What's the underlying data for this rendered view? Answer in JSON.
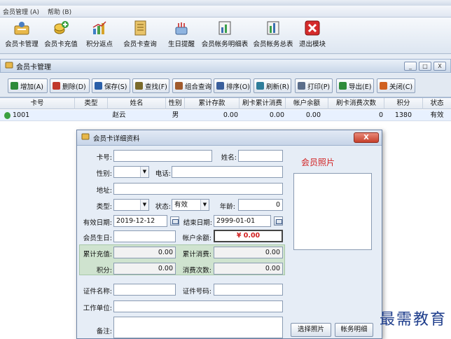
{
  "menubar": {
    "items": [
      "会员管理 (A)",
      "帮助 (B)"
    ]
  },
  "toolbar": {
    "buttons": [
      {
        "label": "会员卡管理",
        "icon": "member-card-icon"
      },
      {
        "label": "会员卡充值",
        "icon": "coins-add-icon"
      },
      {
        "label": "积分返点",
        "icon": "chart-icon"
      },
      {
        "label": "会员卡查询",
        "icon": "notebook-icon"
      },
      {
        "label": "生日提醒",
        "icon": "birthday-icon"
      },
      {
        "label": "会员帐务明细表",
        "icon": "ledger-icon"
      },
      {
        "label": "会员帐务总表",
        "icon": "summary-ledger-icon"
      },
      {
        "label": "退出模块",
        "icon": "exit-icon"
      }
    ]
  },
  "child_window": {
    "title": "会员卡管理",
    "controls": [
      "_",
      "□",
      "X"
    ]
  },
  "actions": [
    {
      "label": "增加(A)",
      "color": "#2e8b3a"
    },
    {
      "label": "删除(D)",
      "color": "#c0392b"
    },
    {
      "label": "保存(S)",
      "color": "#2b5fa8"
    },
    {
      "label": "查找(F)",
      "color": "#7a6a2b"
    },
    {
      "label": "组合查询",
      "color": "#a05a2c"
    },
    {
      "label": "排序(O)",
      "color": "#3a5f9c"
    },
    {
      "label": "刷新(R)",
      "color": "#2e7d9a"
    },
    {
      "label": "打印(P)",
      "color": "#5a6d8a"
    },
    {
      "label": "导出(E)",
      "color": "#2e8b3a"
    },
    {
      "label": "关闭(C)",
      "color": "#d06020"
    }
  ],
  "table": {
    "columns": [
      "卡号",
      "类型",
      "姓名",
      "性别",
      "累计存款",
      "刷卡累计消费",
      "帐户余额",
      "刷卡消费次数",
      "积分",
      "状态"
    ],
    "rows": [
      [
        "1001",
        "",
        "赵云",
        "男",
        "0.00",
        "0.00",
        "0.00",
        "0",
        "1380",
        "有效"
      ]
    ]
  },
  "dialog": {
    "title": "会员卡详细资料",
    "close_label": "X",
    "labels": {
      "card_no": "卡号:",
      "name": "姓名:",
      "gender": "性别:",
      "phone": "电话:",
      "address": "地址:",
      "type": "类型:",
      "status": "状态:",
      "age": "年龄:",
      "valid_date": "有效日期:",
      "end_date": "结束日期:",
      "birthday": "会员生日:",
      "balance": "帐户余额:",
      "total_recharge": "累计充值:",
      "total_consume": "累计消费:",
      "points": "积分:",
      "consume_count": "消费次数:",
      "cert_name": "证件名称:",
      "cert_no": "证件号码:",
      "workplace": "工作单位:",
      "remark": "备注:"
    },
    "values": {
      "card_no": "",
      "name": "",
      "gender": "",
      "phone": "",
      "address": "",
      "type": "",
      "status": "有效",
      "age": "0",
      "valid_date": "2019-12-12",
      "end_date": "2999-01-01",
      "birthday": "",
      "balance": "¥ 0.00",
      "total_recharge": "0.00",
      "total_consume": "0.00",
      "points": "0.00",
      "consume_count": "0.00",
      "cert_name": "",
      "cert_no": "",
      "workplace": "",
      "remark": ""
    },
    "photo_title": "会员照片",
    "select_photo": "选择照片",
    "account_detail": "帐务明细",
    "balance_color": "#d11f1f"
  },
  "watermark": "最需教育"
}
